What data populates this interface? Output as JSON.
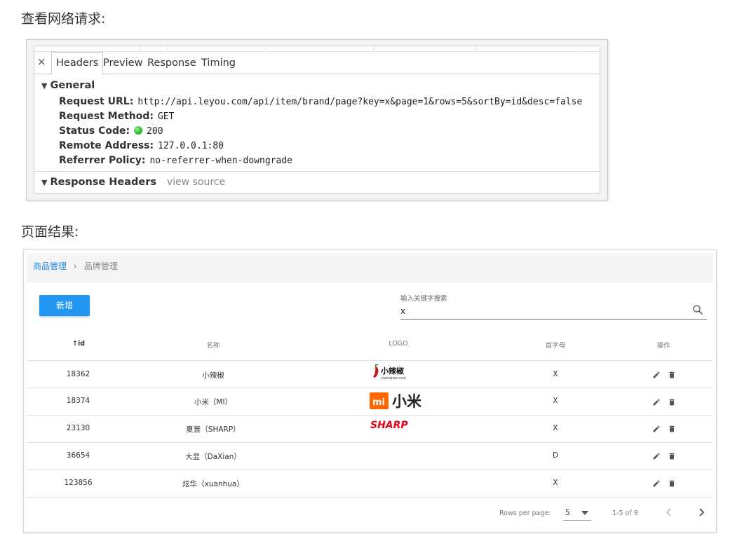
{
  "headings": {
    "network": "查看网络请求:",
    "result": "页面结果:"
  },
  "devtools": {
    "tabs": [
      "Headers",
      "Preview",
      "Response",
      "Timing"
    ],
    "active_tab": "Headers",
    "close_label": "×",
    "general": {
      "title": "General",
      "request_url_label": "Request URL:",
      "request_url": "http://api.leyou.com/api/item/brand/page?key=x&page=1&rows=5&sortBy=id&desc=false",
      "method_label": "Request Method:",
      "method": "GET",
      "status_label": "Status Code:",
      "status": "200",
      "remote_label": "Remote Address:",
      "remote": "127.0.0.1:80",
      "referrer_label": "Referrer Policy:",
      "referrer": "no-referrer-when-downgrade"
    },
    "response_headers": {
      "title": "Response Headers",
      "view_source": "view source"
    },
    "status_color": "#1fae1f"
  },
  "app": {
    "breadcrumb": {
      "parent": "商品管理",
      "separator": "›",
      "current": "品牌管理"
    },
    "add_button": "新增",
    "search": {
      "label": "输入关键字搜索",
      "value": "x"
    },
    "columns": {
      "id": "id",
      "name": "名称",
      "logo": "LOGO",
      "letter": "首字母",
      "actions": "操作"
    },
    "rows": [
      {
        "id": "18362",
        "name": "小辣椒",
        "logo": "小辣椒",
        "logo_sub": "xiaolajiao.com",
        "letter": "X"
      },
      {
        "id": "18374",
        "name": "小米（MI）",
        "logo": "小米",
        "logo_badge": "mi",
        "letter": "X"
      },
      {
        "id": "23130",
        "name": "夏普（SHARP）",
        "logo": "SHARP",
        "letter": "X"
      },
      {
        "id": "36654",
        "name": "大显（DaXian）",
        "logo": "",
        "letter": "D"
      },
      {
        "id": "123856",
        "name": "炫华（xuanhua）",
        "logo": "",
        "letter": "X"
      }
    ],
    "pagination": {
      "rows_per_page_label": "Rows per page:",
      "rows_per_page": "5",
      "range": "1-5 of 9"
    },
    "colors": {
      "accent": "#2196f3",
      "link": "#1e88e5",
      "mi_orange": "#ff6700",
      "sharp_red": "#e60012"
    }
  }
}
